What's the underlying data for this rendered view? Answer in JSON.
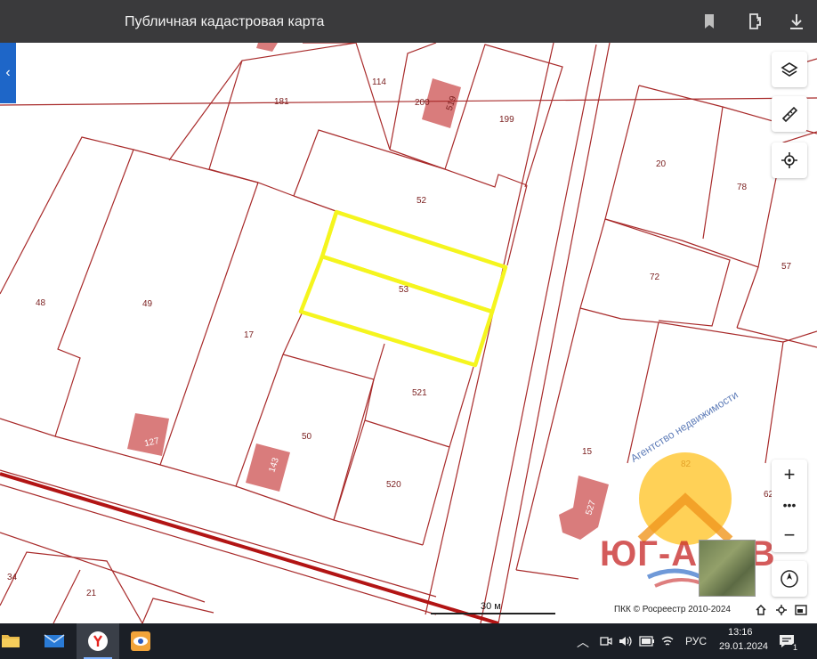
{
  "browser": {
    "title": "Публичная кадастровая карта"
  },
  "map": {
    "parcel_labels": [
      "114",
      "181",
      "200",
      "519",
      "199",
      "20",
      "78",
      "52",
      "72",
      "57",
      "48",
      "49",
      "17",
      "53",
      "521",
      "50",
      "520",
      "127",
      "143",
      "15",
      "527",
      "82",
      "62",
      "34",
      "21"
    ],
    "scale_label": "30 м",
    "copyright": "ПКК © Росреестр 2010-2024",
    "highlight_color": "#f5f51e",
    "line_color": "#a82a2a",
    "building_color": "#d97c7c"
  },
  "watermark": {
    "brand": "ЮГ-АЗОВ",
    "subtitle": "Агентство недвижимости"
  },
  "taskbar": {
    "language": "РУС",
    "time": "13:16",
    "date": "29.01.2024",
    "notification_count": "1"
  }
}
